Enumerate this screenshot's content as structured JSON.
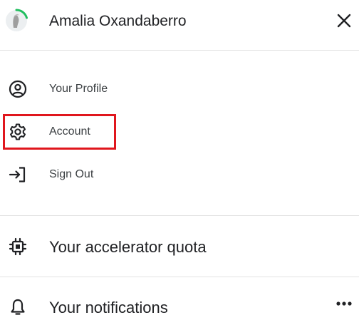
{
  "header": {
    "user_name": "Amalia Oxandaberro",
    "avatar_icon": "avatar-icon",
    "close_icon": "close-icon"
  },
  "menu": {
    "items": [
      {
        "label": "Your Profile",
        "icon": "user-circle-icon"
      },
      {
        "label": "Account",
        "icon": "gear-icon"
      },
      {
        "label": "Sign Out",
        "icon": "sign-out-icon"
      }
    ]
  },
  "sections": [
    {
      "label": "Your accelerator quota",
      "icon": "chip-icon"
    },
    {
      "label": "Your notifications",
      "icon": "bell-icon"
    }
  ],
  "colors": {
    "highlight": "#e0161d",
    "avatar_ring": "#20be5e"
  }
}
